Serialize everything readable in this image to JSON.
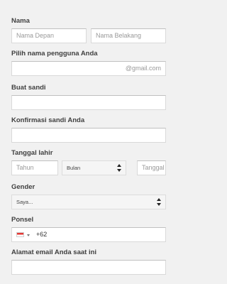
{
  "form": {
    "name": {
      "label": "Nama",
      "first_placeholder": "Nama Depan",
      "last_placeholder": "Nama Belakang"
    },
    "username": {
      "label": "Pilih nama pengguna Anda",
      "suffix": "@gmail.com"
    },
    "password": {
      "label": "Buat sandi"
    },
    "confirm_password": {
      "label": "Konfirmasi sandi Anda"
    },
    "birthdate": {
      "label": "Tanggal lahir",
      "year_placeholder": "Tahun",
      "month_value": "Bulan",
      "day_placeholder": "Tanggal"
    },
    "gender": {
      "label": "Gender",
      "value": "Saya..."
    },
    "phone": {
      "label": "Ponsel",
      "country_code": "+62"
    },
    "email": {
      "label": "Alamat email Anda saat ini"
    }
  },
  "icons": {
    "flag": "indonesia-flag-icon",
    "select_arrows": "updown-arrows-icon"
  },
  "colors": {
    "background": "#f1f1f1",
    "input_border": "#d9d9d9",
    "label_text": "#404040",
    "placeholder_text": "#999999"
  }
}
